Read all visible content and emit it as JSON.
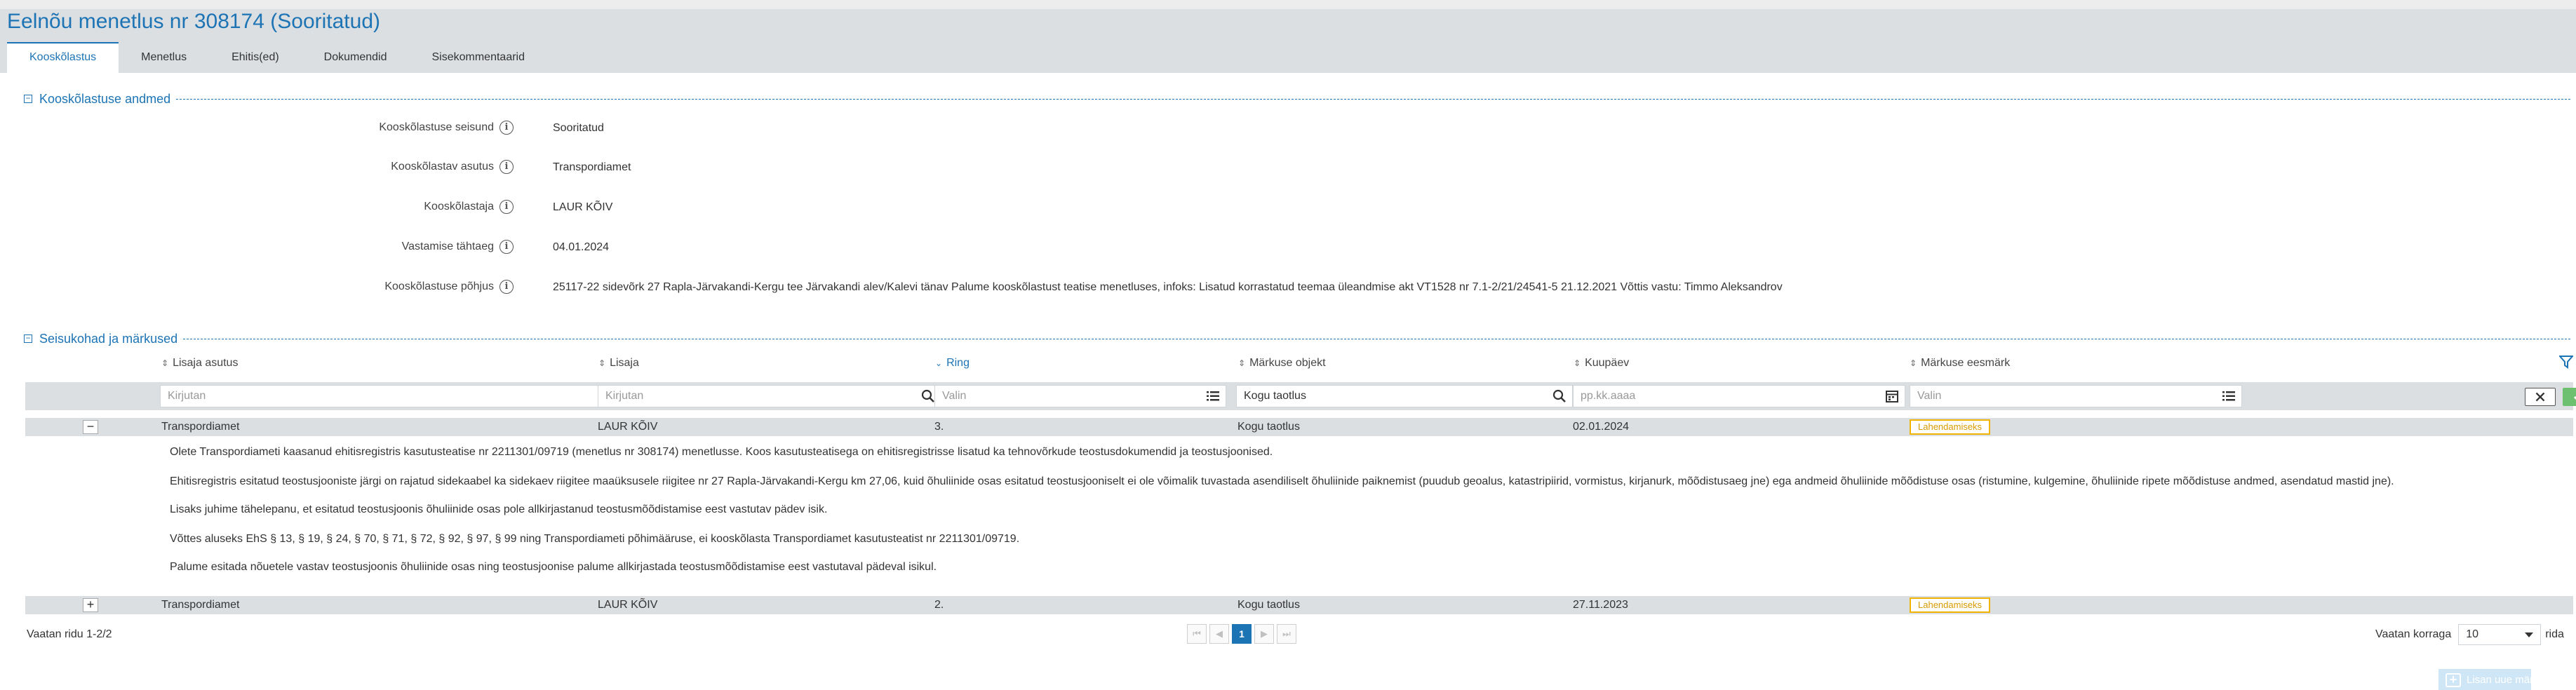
{
  "page": {
    "title": "Eelnõu menetlus nr 308174 (Sooritatud)"
  },
  "tabs": [
    {
      "label": "Kooskõlastus",
      "active": true
    },
    {
      "label": "Menetlus",
      "active": false
    },
    {
      "label": "Ehitis(ed)",
      "active": false
    },
    {
      "label": "Dokumendid",
      "active": false
    },
    {
      "label": "Sisekommentaarid",
      "active": false
    }
  ],
  "section_approval": {
    "title": "Kooskõlastuse andmed",
    "toggle": "−",
    "fields": [
      {
        "label": "Kooskõlastuse seisund",
        "value": "Sooritatud"
      },
      {
        "label": "Kooskõlastav asutus",
        "value": "Transpordiamet"
      },
      {
        "label": "Kooskõlastaja",
        "value": "LAUR KÕIV"
      },
      {
        "label": "Vastamise tähtaeg",
        "value": "04.01.2024"
      },
      {
        "label": "Kooskõlastuse põhjus",
        "value": "25117-22 sidevõrk 27 Rapla-Järvakandi-Kergu tee Järvakandi alev/Kalevi tänav Palume kooskõlastust teatise menetluses, infoks: Lisatud korrastatud teemaa üleandmise akt VT1528 nr 7.1-2/21/24541-5 21.12.2021 Võttis vastu: Timmo Aleksandrov"
      }
    ]
  },
  "section_remarks": {
    "title": "Seisukohad ja märkused",
    "toggle": "−",
    "columns": [
      {
        "label": "Lisaja asutus",
        "sort": "both"
      },
      {
        "label": "Lisaja",
        "sort": "both"
      },
      {
        "label": "Ring",
        "sort": "desc"
      },
      {
        "label": "Märkuse objekt",
        "sort": "both"
      },
      {
        "label": "Kuupäev",
        "sort": "both"
      },
      {
        "label": "Märkuse eesmärk",
        "sort": "both"
      }
    ],
    "filters": [
      {
        "placeholder": "Kirjutan",
        "value": "",
        "icon": "search-icon"
      },
      {
        "placeholder": "Kirjutan",
        "value": "",
        "icon": "search-icon"
      },
      {
        "placeholder": "Valin",
        "value": "",
        "icon": "list-icon"
      },
      {
        "placeholder": "",
        "value": "Kogu taotlus",
        "icon": "search-icon"
      },
      {
        "placeholder": "pp.kk.aaaa",
        "value": "",
        "icon": "calendar-icon"
      },
      {
        "placeholder": "Valin",
        "value": "",
        "icon": "list-icon"
      }
    ],
    "rows": [
      {
        "expander": "−",
        "org": "Transpordiamet",
        "author": "LAUR KÕIV",
        "round": "3.",
        "object": "Kogu taotlus",
        "date": "02.01.2024",
        "purpose": "Lahendamiseks",
        "details": [
          "Olete Transpordiameti kaasanud ehitisregistris kasutusteatise nr 2211301/09719 (menetlus nr 308174) menetlusse. Koos kasutusteatisega on ehitisregistrisse lisatud ka tehnovõrkude teostusdokumendid ja teostusjoonised.",
          "Ehitisregistris esitatud teostusjooniste järgi on rajatud sidekaabel ka sidekaev riigitee maaüksusele riigitee nr 27 Rapla-Järvakandi-Kergu km 27,06, kuid õhuliinide osas esitatud teostusjooniselt ei ole võimalik tuvastada asendiliselt õhuliinide paiknemist (puudub geoalus, katastripiirid, vormistus, kirjanurk, mõõdistusaeg jne) ega andmeid õhuliinide mõõdistuse osas (ristumine, kulgemine, õhuliinide ripete mõõdistuse andmed, asendatud mastid jne).",
          "Lisaks juhime tähelepanu, et esitatud teostusjoonis õhuliinide osas pole allkirjastanud teostusmõõdistamise eest vastutav pädev isik.",
          "Võttes aluseks EhS § 13, § 19, § 24, § 70, § 71, § 72, § 92, § 97, § 99 ning Transpordiameti põhimääruse, ei kooskõlasta Transpordiamet kasutusteatist nr 2211301/09719.",
          "Palume esitada nõuetele vastav teostusjoonis õhuliinide osas ning teostusjoonise palume allkirjastada teostusmõõdistamise eest vastutaval pädeval isikul."
        ]
      },
      {
        "expander": "+",
        "org": "Transpordiamet",
        "author": "LAUR KÕIV",
        "round": "2.",
        "object": "Kogu taotlus",
        "date": "27.11.2023",
        "purpose": "Lahendamiseks",
        "details": []
      }
    ]
  },
  "footer": {
    "rows_text": "Vaatan ridu 1-2/2",
    "pager": {
      "first": "⏮",
      "prev": "◀",
      "current": "1",
      "next": "▶",
      "last": "⏭"
    },
    "per_page_label": "Vaatan korraga",
    "per_page_value": "10",
    "per_page_suffix": "rida"
  },
  "add_button": {
    "label": "Lisan uue märkuse"
  },
  "colors": {
    "accent": "#1d74b5",
    "band": "#dcdfe2",
    "badge": "#f0b400",
    "confirm": "#6cc070"
  }
}
